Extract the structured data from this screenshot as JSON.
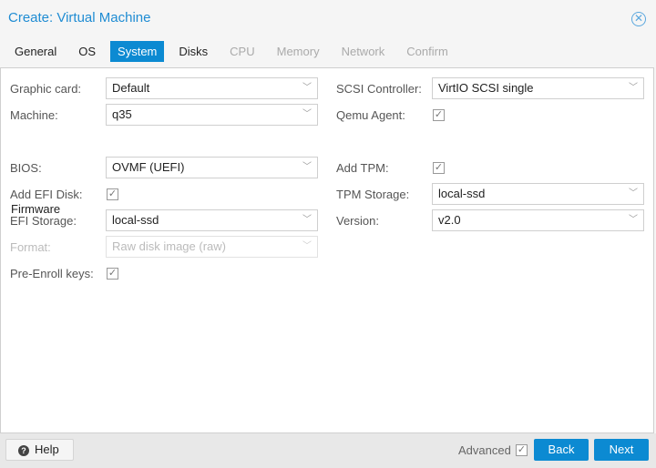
{
  "dialog": {
    "title": "Create: Virtual Machine"
  },
  "tabs": [
    {
      "label": "General"
    },
    {
      "label": "OS"
    },
    {
      "label": "System"
    },
    {
      "label": "Disks"
    },
    {
      "label": "CPU"
    },
    {
      "label": "Memory"
    },
    {
      "label": "Network"
    },
    {
      "label": "Confirm"
    }
  ],
  "form": {
    "graphic_card": {
      "label": "Graphic card:",
      "value": "Default"
    },
    "machine": {
      "label": "Machine:",
      "value": "q35"
    },
    "scsi_controller": {
      "label": "SCSI Controller:",
      "value": "VirtIO SCSI single"
    },
    "qemu_agent": {
      "label": "Qemu Agent:",
      "checked": true
    },
    "firmware_title": "Firmware",
    "bios": {
      "label": "BIOS:",
      "value": "OVMF (UEFI)"
    },
    "add_efi_disk": {
      "label": "Add EFI Disk:",
      "checked": true
    },
    "efi_storage": {
      "label": "EFI Storage:",
      "value": "local-ssd"
    },
    "format": {
      "label": "Format:",
      "value": "Raw disk image (raw)"
    },
    "pre_enroll": {
      "label": "Pre-Enroll keys:",
      "checked": true
    },
    "add_tpm": {
      "label": "Add TPM:",
      "checked": true
    },
    "tpm_storage": {
      "label": "TPM Storage:",
      "value": "local-ssd"
    },
    "version": {
      "label": "Version:",
      "value": "v2.0"
    }
  },
  "footer": {
    "help": "Help",
    "advanced": "Advanced",
    "back": "Back",
    "next": "Next"
  }
}
